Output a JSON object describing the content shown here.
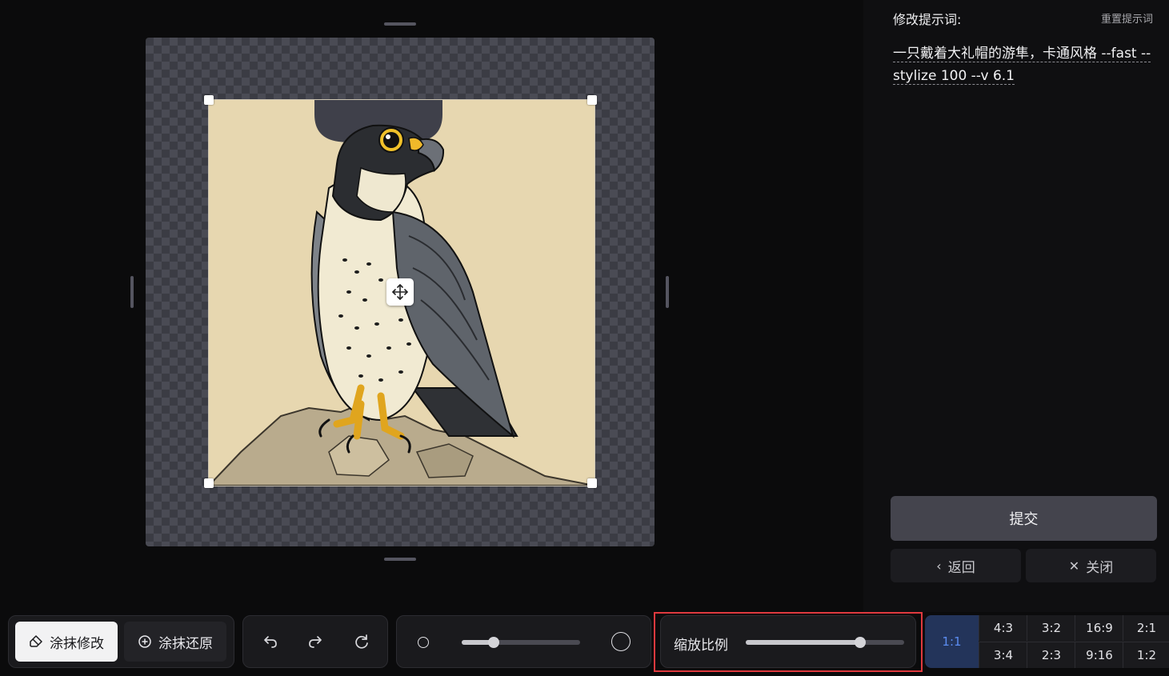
{
  "panel": {
    "title": "修改提示词:",
    "reset_label": "重置提示词",
    "prompt_text": "一只戴着大礼帽的游隼，卡通风格 --fast --stylize 100 --v 6.1",
    "submit_label": "提交",
    "back_label": "返回",
    "close_label": "关闭"
  },
  "toolbar": {
    "erase_modify_label": "涂抹修改",
    "erase_restore_label": "涂抹还原",
    "zoom_label": "缩放比例",
    "brush_size_fraction": 0.27,
    "zoom_fraction": 0.72
  },
  "ratios": {
    "active": "1:1",
    "top_row": [
      "4:3",
      "3:2",
      "16:9",
      "2:1"
    ],
    "bottom_row": [
      "3:4",
      "2:3",
      "9:16",
      "1:2"
    ]
  },
  "icons": {
    "back": "chevron-left-icon",
    "close": "close-icon",
    "erase_modify": "eraser-icon",
    "erase_restore": "plus-circle-icon",
    "undo": "undo-icon",
    "redo": "redo-icon",
    "reset": "refresh-icon",
    "move": "move-icon"
  },
  "colors": {
    "accent": "#5b8cf0",
    "highlight_border": "#e0393e"
  }
}
